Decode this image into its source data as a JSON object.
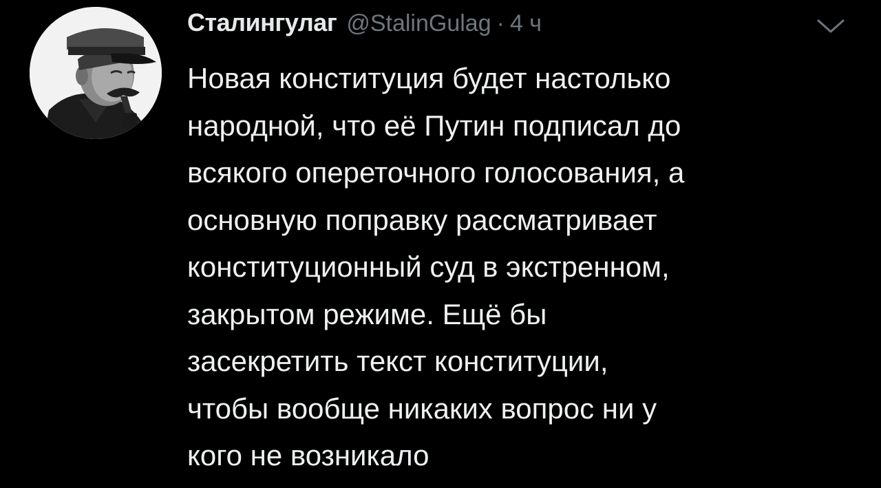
{
  "tweet": {
    "author": {
      "display_name": "Сталингулаг",
      "handle": "@StalinGulag",
      "avatar_icon": "stalin-portrait-avatar"
    },
    "separator": "·",
    "timestamp": "4 ч",
    "menu_icon": "chevron-down-icon",
    "text_lines": [
      "Новая конституция будет настолько",
      "народной, что её Путин подписал до",
      "всякого опереточного голосования, а",
      "основную поправку рассматривает",
      "конституционный суд в экстренном,",
      "закрытом режиме. Ещё бы",
      "засекретить текст конституции,",
      "чтобы вообще никаких вопрос ни у",
      "кого не возникало"
    ]
  },
  "colors": {
    "background": "#000000",
    "primary_text": "#e7e9ea",
    "secondary_text": "#6e767d"
  }
}
